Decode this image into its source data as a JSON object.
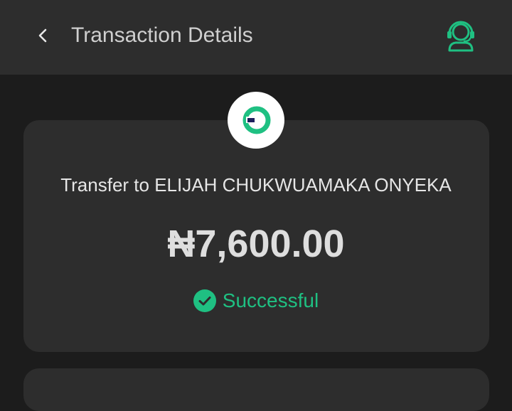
{
  "header": {
    "title": "Transaction Details",
    "back_icon": "chevron-left-icon",
    "support_icon": "customer-support-headset-icon"
  },
  "transaction": {
    "logo_icon": "opay-logo",
    "recipient_line": "Transfer to ELIJAH CHUKWUAMAKA ONYEKA",
    "amount": "₦7,600.00",
    "status": "Successful",
    "status_icon": "check-circle-icon"
  },
  "colors": {
    "header_bg": "#2d2d2d",
    "page_bg": "#1c1c1c",
    "card_bg": "#2d2d2d",
    "accent_green": "#1fc082",
    "logo_navy": "#1e1f5c"
  }
}
